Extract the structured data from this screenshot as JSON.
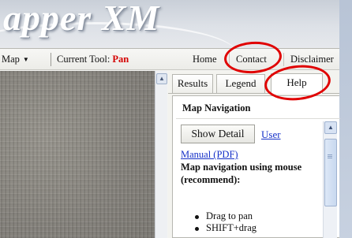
{
  "banner": {
    "title": "apper XM"
  },
  "toolbar": {
    "map_menu_label": "Map",
    "current_tool_label": "Current Tool:",
    "current_tool_value": "Pan",
    "current_tool_color": "#d40000",
    "nav": {
      "home": "Home",
      "contact": "Contact",
      "disclaimer": "Disclaimer"
    }
  },
  "panel": {
    "tabs": {
      "results": "Results",
      "legend": "Legend",
      "help": "Help"
    },
    "active_tab": "Help",
    "help": {
      "heading": "Map Navigation",
      "show_detail_button": "Show Detail",
      "user_link": "User",
      "manual_link": "Manual (PDF)",
      "intro_text": "Map navigation using mouse (recommend):",
      "list_items": [
        "Drag to pan",
        "SHIFT+drag"
      ]
    }
  },
  "annotations": {
    "color": "#e00000",
    "circled": [
      "Contact",
      "Help"
    ]
  }
}
